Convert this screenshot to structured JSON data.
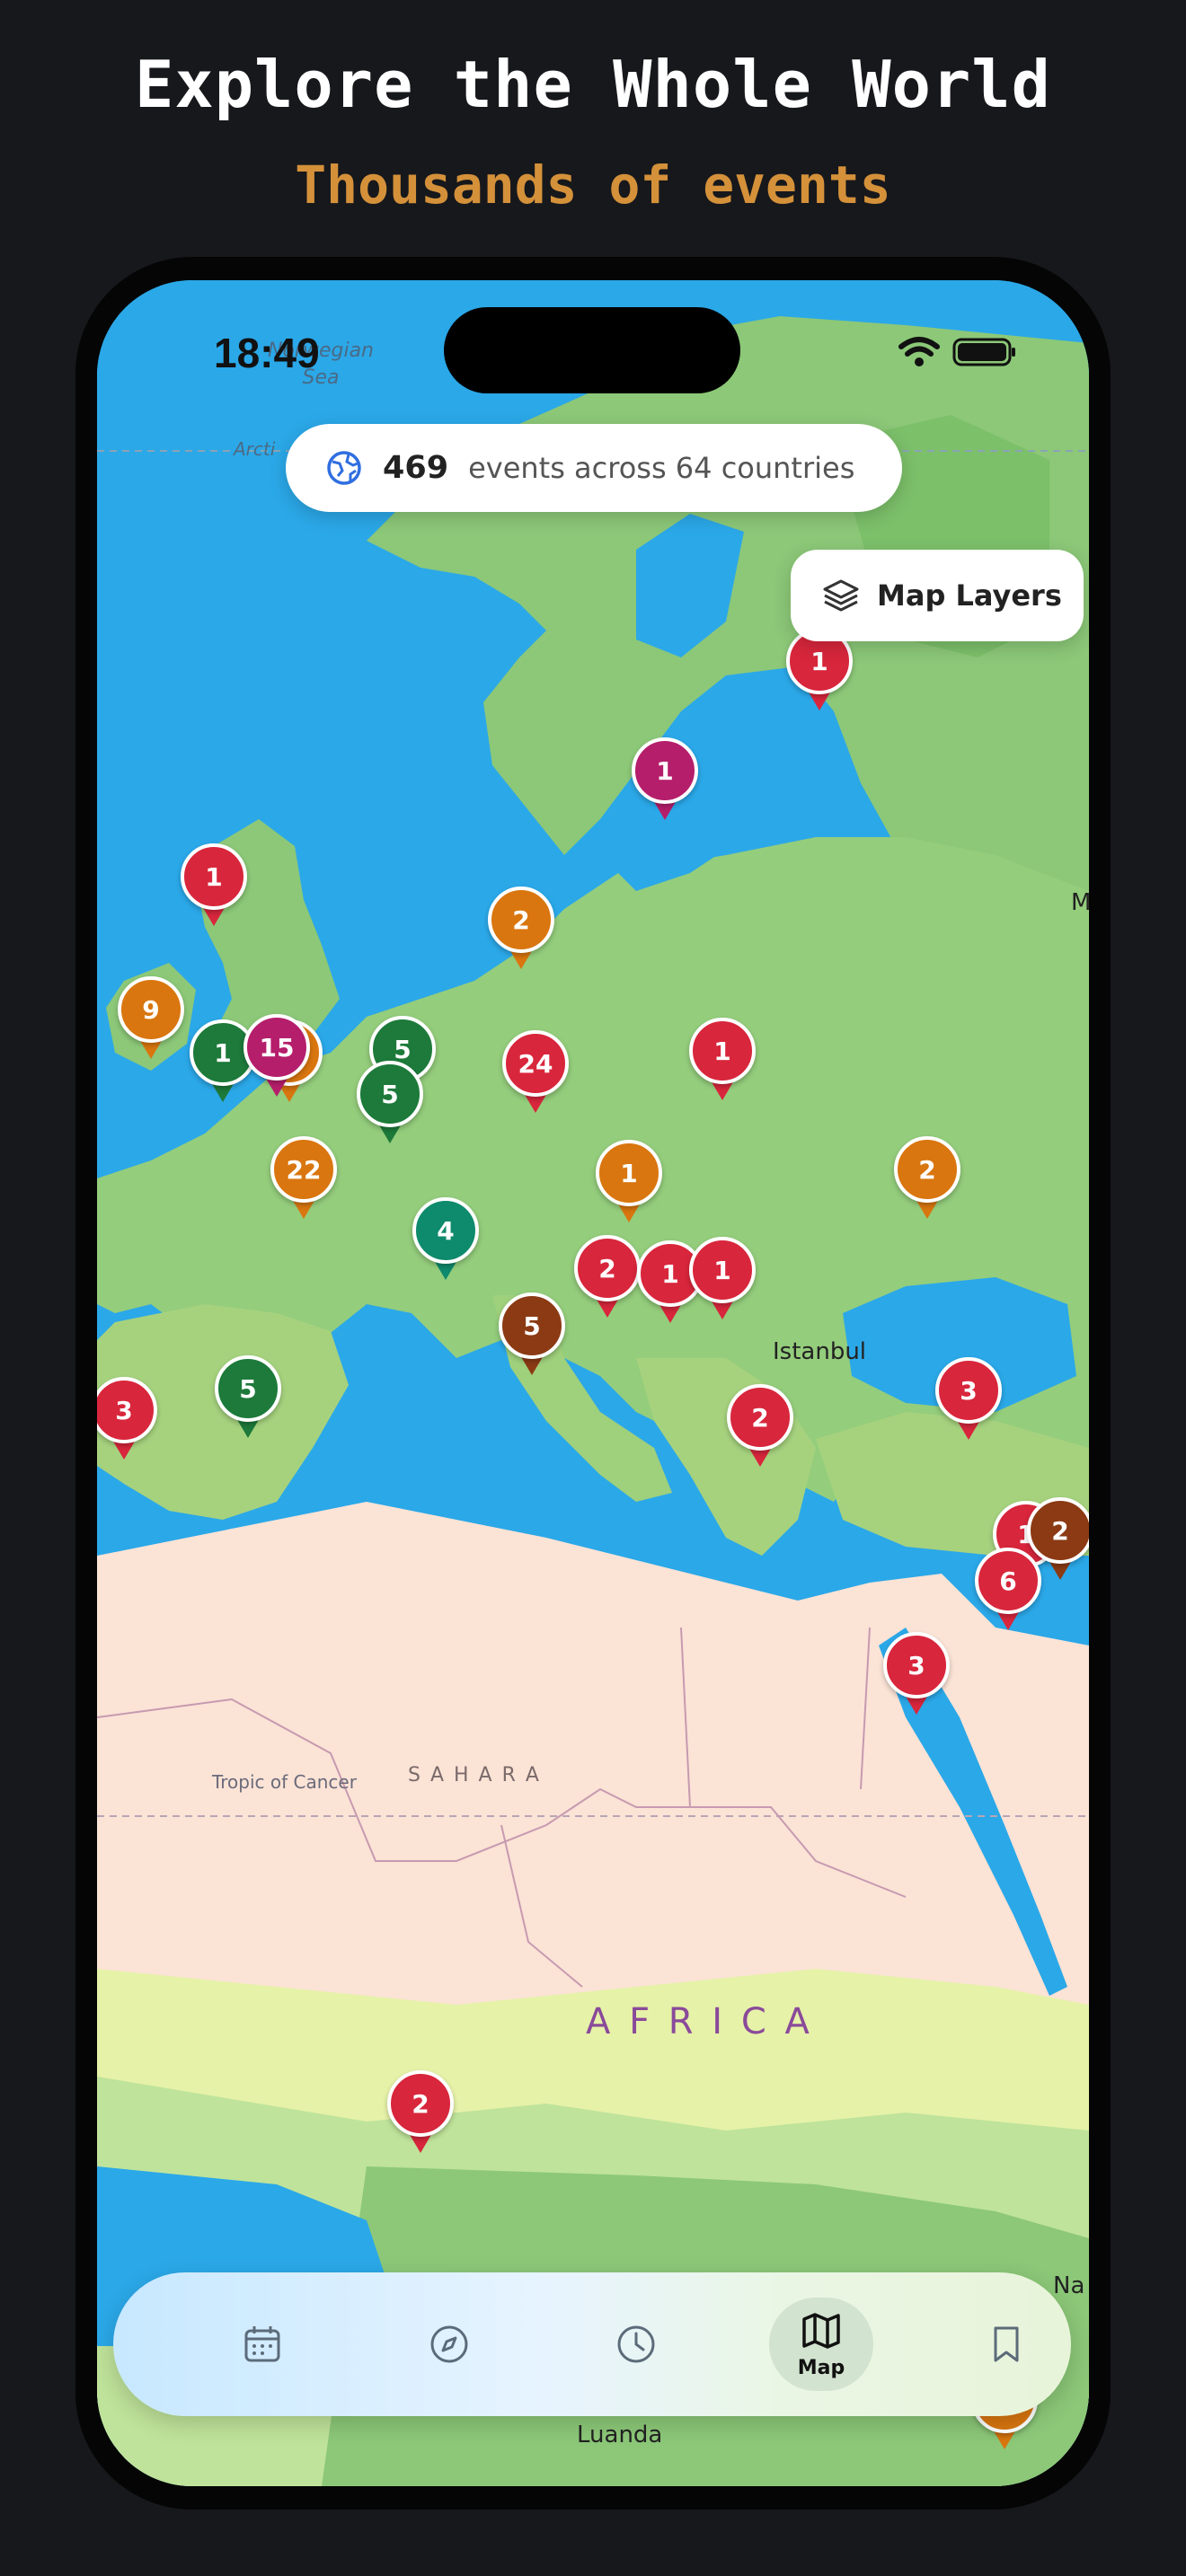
{
  "header": {
    "title": "Explore the Whole World",
    "subtitle": "Thousands of events"
  },
  "status_bar": {
    "time": "18:49"
  },
  "summary": {
    "count": "469",
    "text": "events across 64 countries"
  },
  "map_layers_button": {
    "label": "Map Layers"
  },
  "map_labels": {
    "norwegian_sea": "Norwegian\nSea",
    "arctic": "Arcti",
    "istanbul": "Istanbul",
    "sahara": "S A H A R A",
    "tropic": "Tropic of Cancer",
    "africa": "A F R I C A",
    "luanda": "Luanda",
    "edge_m": "M",
    "edge_na": "Na"
  },
  "markers": [
    {
      "label": "1",
      "color": "#d8263c",
      "icon": "map-pin"
    },
    {
      "label": "1",
      "color": "#b51e6b",
      "icon": "map-pin"
    },
    {
      "label": "1",
      "color": "#d8263c",
      "icon": "map-pin"
    },
    {
      "label": "2",
      "color": "#d9760f",
      "icon": "map-pin"
    },
    {
      "label": "9",
      "color": "#d9760f",
      "icon": "map-pin"
    },
    {
      "label": "1",
      "color": "#1d7a3a",
      "icon": "map-pin"
    },
    {
      "label": "",
      "color": "#d9760f",
      "icon": "map-pin"
    },
    {
      "label": "15",
      "color": "#b51e6b",
      "icon": "map-pin"
    },
    {
      "label": "5",
      "color": "#1d7a3a",
      "icon": "map-pin"
    },
    {
      "label": "5",
      "color": "#1d7a3a",
      "icon": "map-pin"
    },
    {
      "label": "24",
      "color": "#d8263c",
      "icon": "map-pin"
    },
    {
      "label": "1",
      "color": "#d8263c",
      "icon": "map-pin"
    },
    {
      "label": "22",
      "color": "#d9760f",
      "icon": "map-pin"
    },
    {
      "label": "1",
      "color": "#d9760f",
      "icon": "map-pin"
    },
    {
      "label": "2",
      "color": "#d9760f",
      "icon": "map-pin"
    },
    {
      "label": "4",
      "color": "#0e8a6c",
      "icon": "map-pin"
    },
    {
      "label": "2",
      "color": "#d8263c",
      "icon": "map-pin"
    },
    {
      "label": "1",
      "color": "#d8263c",
      "icon": "map-pin"
    },
    {
      "label": "1",
      "color": "#d8263c",
      "icon": "map-pin"
    },
    {
      "label": "5",
      "color": "#8b3a14",
      "icon": "map-pin"
    },
    {
      "label": "5",
      "color": "#1d7a3a",
      "icon": "map-pin"
    },
    {
      "label": "3",
      "color": "#d8263c",
      "icon": "map-pin"
    },
    {
      "label": "3",
      "color": "#d8263c",
      "icon": "map-pin"
    },
    {
      "label": "2",
      "color": "#d8263c",
      "icon": "map-pin"
    },
    {
      "label": "1",
      "color": "#d8263c",
      "icon": "map-pin"
    },
    {
      "label": "2",
      "color": "#8b3a14",
      "icon": "map-pin"
    },
    {
      "label": "6",
      "color": "#d8263c",
      "icon": "map-pin"
    },
    {
      "label": "3",
      "color": "#d8263c",
      "icon": "map-pin"
    },
    {
      "label": "2",
      "color": "#d8263c",
      "icon": "map-pin"
    },
    {
      "label": "",
      "color": "#d9760f",
      "icon": "map-pin"
    }
  ],
  "tabs": [
    {
      "name": "calendar",
      "icon": "calendar-icon",
      "label": ""
    },
    {
      "name": "discover",
      "icon": "compass-icon",
      "label": ""
    },
    {
      "name": "history",
      "icon": "clock-icon",
      "label": ""
    },
    {
      "name": "map",
      "icon": "map-icon",
      "label": "Map",
      "active": true
    },
    {
      "name": "saved",
      "icon": "bookmark-icon",
      "label": ""
    }
  ]
}
